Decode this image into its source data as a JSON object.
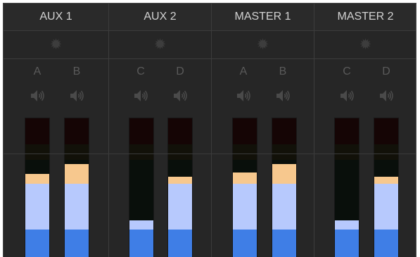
{
  "buses": [
    {
      "name": "AUX 1",
      "settings_icon": "gear-icon",
      "channels": [
        {
          "label": "A",
          "mute_icon": "speaker-icon",
          "level": 0.53,
          "peak": 0.6
        },
        {
          "label": "B",
          "mute_icon": "speaker-icon",
          "level": 0.53,
          "peak": 0.67
        }
      ]
    },
    {
      "name": "AUX 2",
      "settings_icon": "gear-icon",
      "channels": [
        {
          "label": "C",
          "mute_icon": "speaker-icon",
          "level": 0.27,
          "peak": 0.27
        },
        {
          "label": "D",
          "mute_icon": "speaker-icon",
          "level": 0.53,
          "peak": 0.58
        }
      ]
    },
    {
      "name": "MASTER 1",
      "settings_icon": "gear-icon",
      "channels": [
        {
          "label": "A",
          "mute_icon": "speaker-icon",
          "level": 0.53,
          "peak": 0.61
        },
        {
          "label": "B",
          "mute_icon": "speaker-icon",
          "level": 0.53,
          "peak": 0.67
        }
      ]
    },
    {
      "name": "MASTER 2",
      "settings_icon": "gear-icon",
      "channels": [
        {
          "label": "C",
          "mute_icon": "speaker-icon",
          "level": 0.27,
          "peak": 0.27
        },
        {
          "label": "D",
          "mute_icon": "speaker-icon",
          "level": 0.53,
          "peak": 0.58
        }
      ]
    }
  ],
  "colors": {
    "panel_background": "#262626",
    "meter_blue": "#3f7ee6",
    "meter_light_blue": "#b7c9fd",
    "meter_peak": "#f7c88e",
    "label_text": "#5a5a5a",
    "header_text": "#d2d2d2"
  }
}
